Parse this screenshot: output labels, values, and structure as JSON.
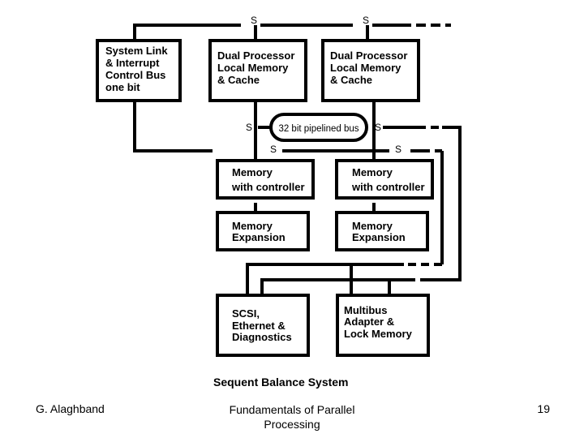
{
  "diagram": {
    "caption": "Sequent Balance System",
    "switch_label": "S",
    "bus_label": "32 bit pipelined bus",
    "boxes": {
      "system_link": [
        "System Link",
        "& Interrupt",
        "Control Bus",
        "one bit"
      ],
      "processor_1": [
        "Dual Processor",
        "Local Memory",
        "& Cache"
      ],
      "processor_2": [
        "Dual Processor",
        "Local Memory",
        "& Cache"
      ],
      "memory_ctrl_1": [
        "Memory",
        "with controller"
      ],
      "memory_ctrl_2": [
        "Memory",
        "with controller"
      ],
      "memory_exp_1": [
        "Memory",
        "Expansion"
      ],
      "memory_exp_2": [
        "Memory",
        "Expansion"
      ],
      "scsi": [
        "SCSI,",
        "Ethernet &",
        "Diagnostics"
      ],
      "multibus": [
        "Multibus",
        "Adapter &",
        "Lock Memory"
      ]
    }
  },
  "footer": {
    "author": "G. Alaghband",
    "title_line1": "Fundamentals of Parallel",
    "title_line2": "Processing",
    "page_number": "19"
  }
}
